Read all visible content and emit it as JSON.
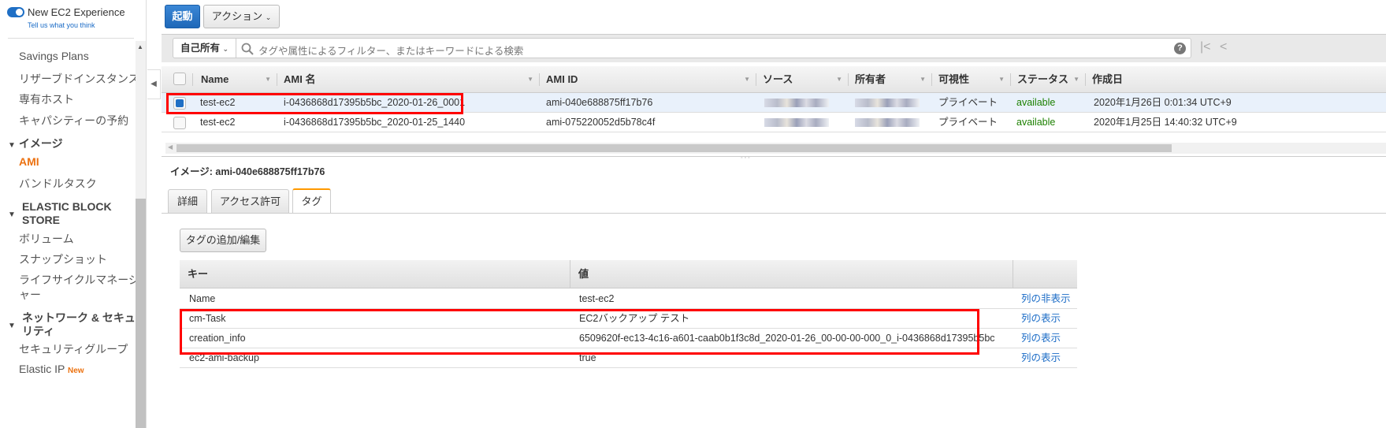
{
  "sidebar": {
    "experience_label": "New EC2 Experience",
    "feedback_link": "Tell us what you think",
    "items": [
      "Savings Plans",
      "リザーブドインスタンス",
      "専有ホスト",
      "キャパシティーの予約"
    ],
    "section_images": "イメージ",
    "images_items": [
      "AMI",
      "バンドルタスク"
    ],
    "section_ebs": [
      "ELASTIC BLOCK",
      "STORE"
    ],
    "ebs_items": [
      "ボリューム",
      "スナップショット",
      "ライフサイクルマネージ",
      "ャー"
    ],
    "section_network": [
      "ネットワーク & セキュ",
      "リティ"
    ],
    "network_items": [
      "セキュリティグループ",
      "Elastic IP"
    ],
    "new_badge": "New",
    "accent": "#ec7211"
  },
  "toolbar": {
    "launch": "起動",
    "actions": "アクション"
  },
  "filter": {
    "owner": "自己所有",
    "placeholder": "タグや属性によるフィルター、またはキーワードによる検索"
  },
  "table": {
    "columns": [
      "Name",
      "AMI 名",
      "AMI ID",
      "ソース",
      "所有者",
      "可視性",
      "ステータス",
      "作成日"
    ],
    "rows": [
      {
        "selected": true,
        "name": "test-ec2",
        "ami_name": "i-0436868d17395b5bc_2020-01-26_0001",
        "ami_id": "ami-040e688875ff17b76",
        "visibility": "プライベート",
        "status": "available",
        "created": "2020年1月26日 0:01:34 UTC+9"
      },
      {
        "selected": false,
        "name": "test-ec2",
        "ami_name": "i-0436868d17395b5bc_2020-01-25_1440",
        "ami_id": "ami-075220052d5b78c4f",
        "visibility": "プライベート",
        "status": "available",
        "created": "2020年1月25日 14:40:32 UTC+9"
      }
    ]
  },
  "detail": {
    "title": "イメージ: ami-040e688875ff17b76",
    "tabs": [
      "詳細",
      "アクセス許可",
      "タグ"
    ],
    "edit_tags": "タグの追加/編集",
    "tag_columns": [
      "キー",
      "値"
    ],
    "tags": [
      {
        "key": "Name",
        "value": "test-ec2",
        "action": "列の非表示"
      },
      {
        "key": "cm-Task",
        "value": "EC2バックアップ テスト",
        "action": "列の表示"
      },
      {
        "key": "creation_info",
        "value": "6509620f-ec13-4c16-a601-caab0b1f3c8d_2020-01-26_00-00-00-000_0_i-0436868d17395b5bc",
        "action": "列の表示"
      },
      {
        "key": "ec2-ami-backup",
        "value": "true",
        "action": "列の表示"
      }
    ]
  }
}
